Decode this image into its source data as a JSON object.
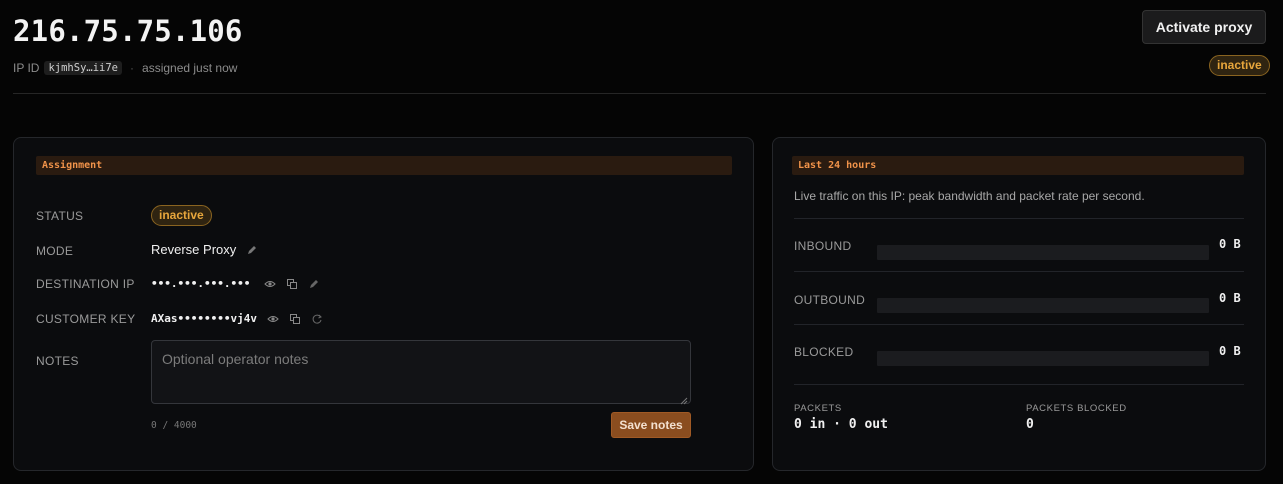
{
  "header": {
    "ip_address": "216.75.75.106",
    "ip_id_label": "IP ID",
    "ip_id_value": "kjmhSy…ii7e",
    "separator": "·",
    "assigned_text": "assigned just now",
    "activate_label": "Activate proxy",
    "status_badge": "inactive"
  },
  "assignment": {
    "section_title": "Assignment",
    "status_label": "STATUS",
    "status_value": "inactive",
    "mode_label": "MODE",
    "mode_value": "Reverse Proxy",
    "destination_label": "DESTINATION IP",
    "destination_value": "•••.•••.•••.•••",
    "customer_key_label": "CUSTOMER KEY",
    "customer_key_value": "AXas••••••••vj4v",
    "notes_label": "NOTES",
    "notes_placeholder": "Optional operator notes",
    "notes_value": "",
    "char_count": "0 / 4000",
    "save_label": "Save notes"
  },
  "traffic": {
    "section_title": "Last 24 hours",
    "description": "Live traffic on this IP: peak bandwidth and packet rate per second.",
    "metrics": [
      {
        "label": "INBOUND",
        "value": "0 B",
        "fill": 0
      },
      {
        "label": "OUTBOUND",
        "value": "0 B",
        "fill": 0
      },
      {
        "label": "BLOCKED",
        "value": "0 B",
        "fill": 0
      }
    ],
    "packets_label": "PACKETS",
    "packets_value": "0 in · 0 out",
    "packets_blocked_label": "PACKETS BLOCKED",
    "packets_blocked_value": "0"
  },
  "colors": {
    "accent": "#e88c3c",
    "badge_inactive": "#e7a63c",
    "save_button": "#8a4d1f"
  },
  "icons": {
    "mode_edit": "pencil-icon",
    "destination_reveal": "eye-icon",
    "destination_copy": "copy-icon",
    "destination_edit": "pencil-icon",
    "key_reveal": "eye-icon",
    "key_copy": "copy-icon",
    "key_rotate": "refresh-icon"
  }
}
